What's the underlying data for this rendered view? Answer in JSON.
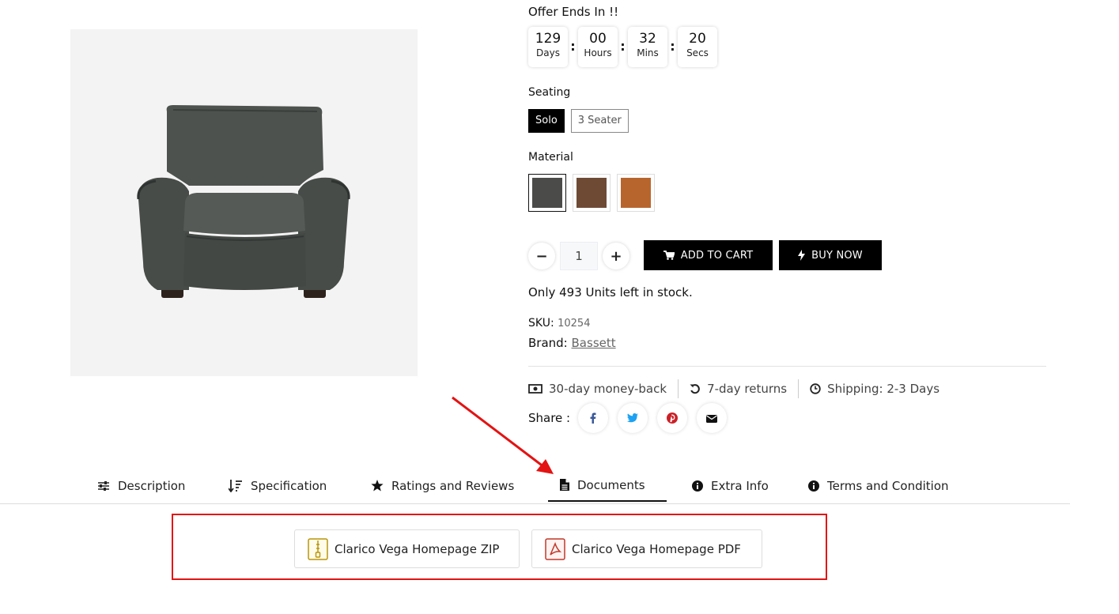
{
  "offer": {
    "label": "Offer Ends In !!",
    "countdown": [
      {
        "value": "129",
        "unit": "Days"
      },
      {
        "value": "00",
        "unit": "Hours"
      },
      {
        "value": "32",
        "unit": "Mins"
      },
      {
        "value": "20",
        "unit": "Secs"
      }
    ],
    "separator": ":"
  },
  "seating": {
    "label": "Seating",
    "options": [
      "Solo",
      "3 Seater"
    ],
    "selected": "Solo"
  },
  "material": {
    "label": "Material",
    "swatches": [
      "#4b4c4a",
      "#6e4a35",
      "#b8652d"
    ],
    "selected_index": 0
  },
  "quantity": {
    "value": "1",
    "minus": "−",
    "plus": "+"
  },
  "buttons": {
    "add_to_cart": "ADD TO CART",
    "buy_now": "BUY NOW"
  },
  "stock_text": "Only 493 Units left in stock.",
  "sku": {
    "label": "SKU:",
    "value": "10254"
  },
  "brand": {
    "label": "Brand:",
    "value": "Bassett"
  },
  "policies": {
    "money_back": "30-day money-back",
    "returns": "7-day returns",
    "shipping": "Shipping: 2-3 Days"
  },
  "share": {
    "label": "Share :",
    "icons": [
      "facebook-icon",
      "twitter-icon",
      "pinterest-icon",
      "email-icon"
    ]
  },
  "tabs": {
    "description": "Description",
    "specification": "Specification",
    "ratings": "Ratings and Reviews",
    "documents": "Documents",
    "extra_info": "Extra Info",
    "terms": "Terms and Condition",
    "active": "Documents"
  },
  "documents": {
    "zip": "Clarico Vega Homepage ZIP",
    "pdf": "Clarico Vega Homepage PDF"
  },
  "colors": {
    "highlight": "#e31313",
    "button_dark": "#000000",
    "facebook": "#3b5998",
    "twitter": "#1da1f2",
    "pinterest": "#cb2027",
    "zip_icon": "#b8960c",
    "pdf_icon": "#c0392b"
  }
}
